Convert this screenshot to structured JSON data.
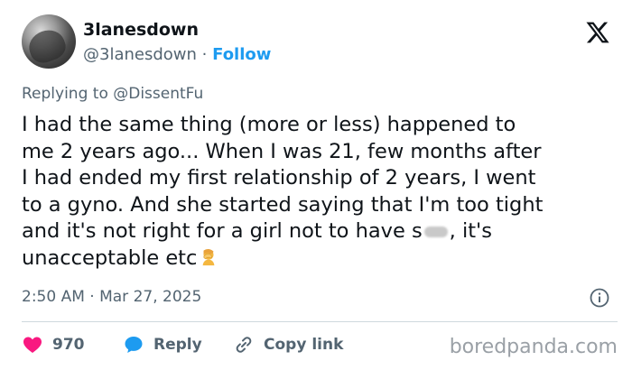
{
  "author": {
    "display_name": "3lanesdown",
    "handle": "@3lanesdown",
    "separator": "·",
    "follow_label": "Follow"
  },
  "replying_to": "Replying to @DissentFu",
  "tweet_lines": [
    "I had the same thing (more or less) happened to",
    "me 2 years ago... When I was 21, few months after",
    "I had ended my first relationship of 2 years, I went",
    "to a gyno. And she started saying that I'm too tight",
    "and it's not right for a girl not to have s",
    ", it's",
    "unacceptable etc"
  ],
  "timestamp": "2:50 AM · Mar 27, 2025",
  "actions": {
    "likes": "970",
    "reply_label": "Reply",
    "copy_link_label": "Copy link"
  },
  "watermark": "boredpanda.com",
  "colors": {
    "accent": "#1d9bf0",
    "like": "#f91880",
    "text": "#0f1419",
    "muted": "#536471"
  },
  "icons": [
    "x-logo-icon",
    "info-icon",
    "heart-icon",
    "reply-bubble-icon",
    "link-icon",
    "facepalm-emoji-icon"
  ]
}
